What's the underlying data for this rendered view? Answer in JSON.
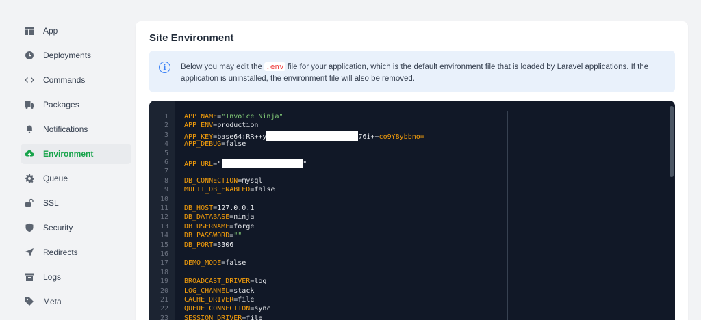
{
  "sidebar": {
    "items": [
      {
        "label": "App",
        "icon": "layout-icon",
        "active": false
      },
      {
        "label": "Deployments",
        "icon": "clock-icon",
        "active": false
      },
      {
        "label": "Commands",
        "icon": "code-icon",
        "active": false
      },
      {
        "label": "Packages",
        "icon": "truck-icon",
        "active": false
      },
      {
        "label": "Notifications",
        "icon": "bell-icon",
        "active": false
      },
      {
        "label": "Environment",
        "icon": "cloud-upload-icon",
        "active": true
      },
      {
        "label": "Queue",
        "icon": "gear-icon",
        "active": false
      },
      {
        "label": "SSL",
        "icon": "unlock-icon",
        "active": false
      },
      {
        "label": "Security",
        "icon": "shield-icon",
        "active": false
      },
      {
        "label": "Redirects",
        "icon": "send-icon",
        "active": false
      },
      {
        "label": "Logs",
        "icon": "archive-icon",
        "active": false
      },
      {
        "label": "Meta",
        "icon": "tag-icon",
        "active": false
      }
    ],
    "active_color": "#16a34a"
  },
  "page": {
    "title": "Site Environment",
    "info": {
      "icon": "info-icon",
      "text_before": "Below you may edit the ",
      "code": ".env",
      "text_after": " file for your application, which is the default environment file that is loaded by Laravel applications. If the application is uninstalled, the environment file will also be removed."
    }
  },
  "editor": {
    "colors": {
      "key": "#f59e0b",
      "value": "#e5e7eb",
      "string": "#86d17a",
      "background": "#111827"
    },
    "lines": [
      {
        "n": "1",
        "key": "APP_NAME",
        "eq": "=",
        "val": "\"Invoice Ninja\"",
        "str": true
      },
      {
        "n": "2",
        "key": "APP_ENV",
        "eq": "=",
        "val": "production"
      },
      {
        "n": "3",
        "key": "APP_KEY",
        "eq": "=",
        "val": "base64:RR++y",
        "redacted": true,
        "after_redact": "76i++",
        "tail": "co9Y8ybbno="
      },
      {
        "n": "4",
        "key": "APP_DEBUG",
        "eq": "=",
        "val": "false"
      },
      {
        "n": "5"
      },
      {
        "n": "6",
        "key": "APP_URL",
        "eq": "=",
        "val": "\"",
        "redacted_url": true,
        "tail_q": "\""
      },
      {
        "n": "7"
      },
      {
        "n": "8",
        "key": "DB_CONNECTION",
        "eq": "=",
        "val": "mysql"
      },
      {
        "n": "9",
        "key": "MULTI_DB_ENABLED",
        "eq": "=",
        "val": "false"
      },
      {
        "n": "10"
      },
      {
        "n": "11",
        "key": "DB_HOST",
        "eq": "=",
        "val": "127.0.0.1"
      },
      {
        "n": "12",
        "key": "DB_DATABASE",
        "eq": "=",
        "val": "ninja"
      },
      {
        "n": "13",
        "key": "DB_USERNAME",
        "eq": "=",
        "val": "forge"
      },
      {
        "n": "14",
        "key": "DB_PASSWORD",
        "eq": "=",
        "val": "\"\"",
        "str": true
      },
      {
        "n": "15",
        "key": "DB_PORT",
        "eq": "=",
        "val": "3306"
      },
      {
        "n": "16"
      },
      {
        "n": "17",
        "key": "DEMO_MODE",
        "eq": "=",
        "val": "false"
      },
      {
        "n": "18"
      },
      {
        "n": "19",
        "key": "BROADCAST_DRIVER",
        "eq": "=",
        "val": "log"
      },
      {
        "n": "20",
        "key": "LOG_CHANNEL",
        "eq": "=",
        "val": "stack"
      },
      {
        "n": "21",
        "key": "CACHE_DRIVER",
        "eq": "=",
        "val": "file"
      },
      {
        "n": "22",
        "key": "QUEUE_CONNECTION",
        "eq": "=",
        "val": "sync"
      },
      {
        "n": "23",
        "key": "SESSION_DRIVER",
        "eq": "=",
        "val": "file"
      }
    ]
  }
}
